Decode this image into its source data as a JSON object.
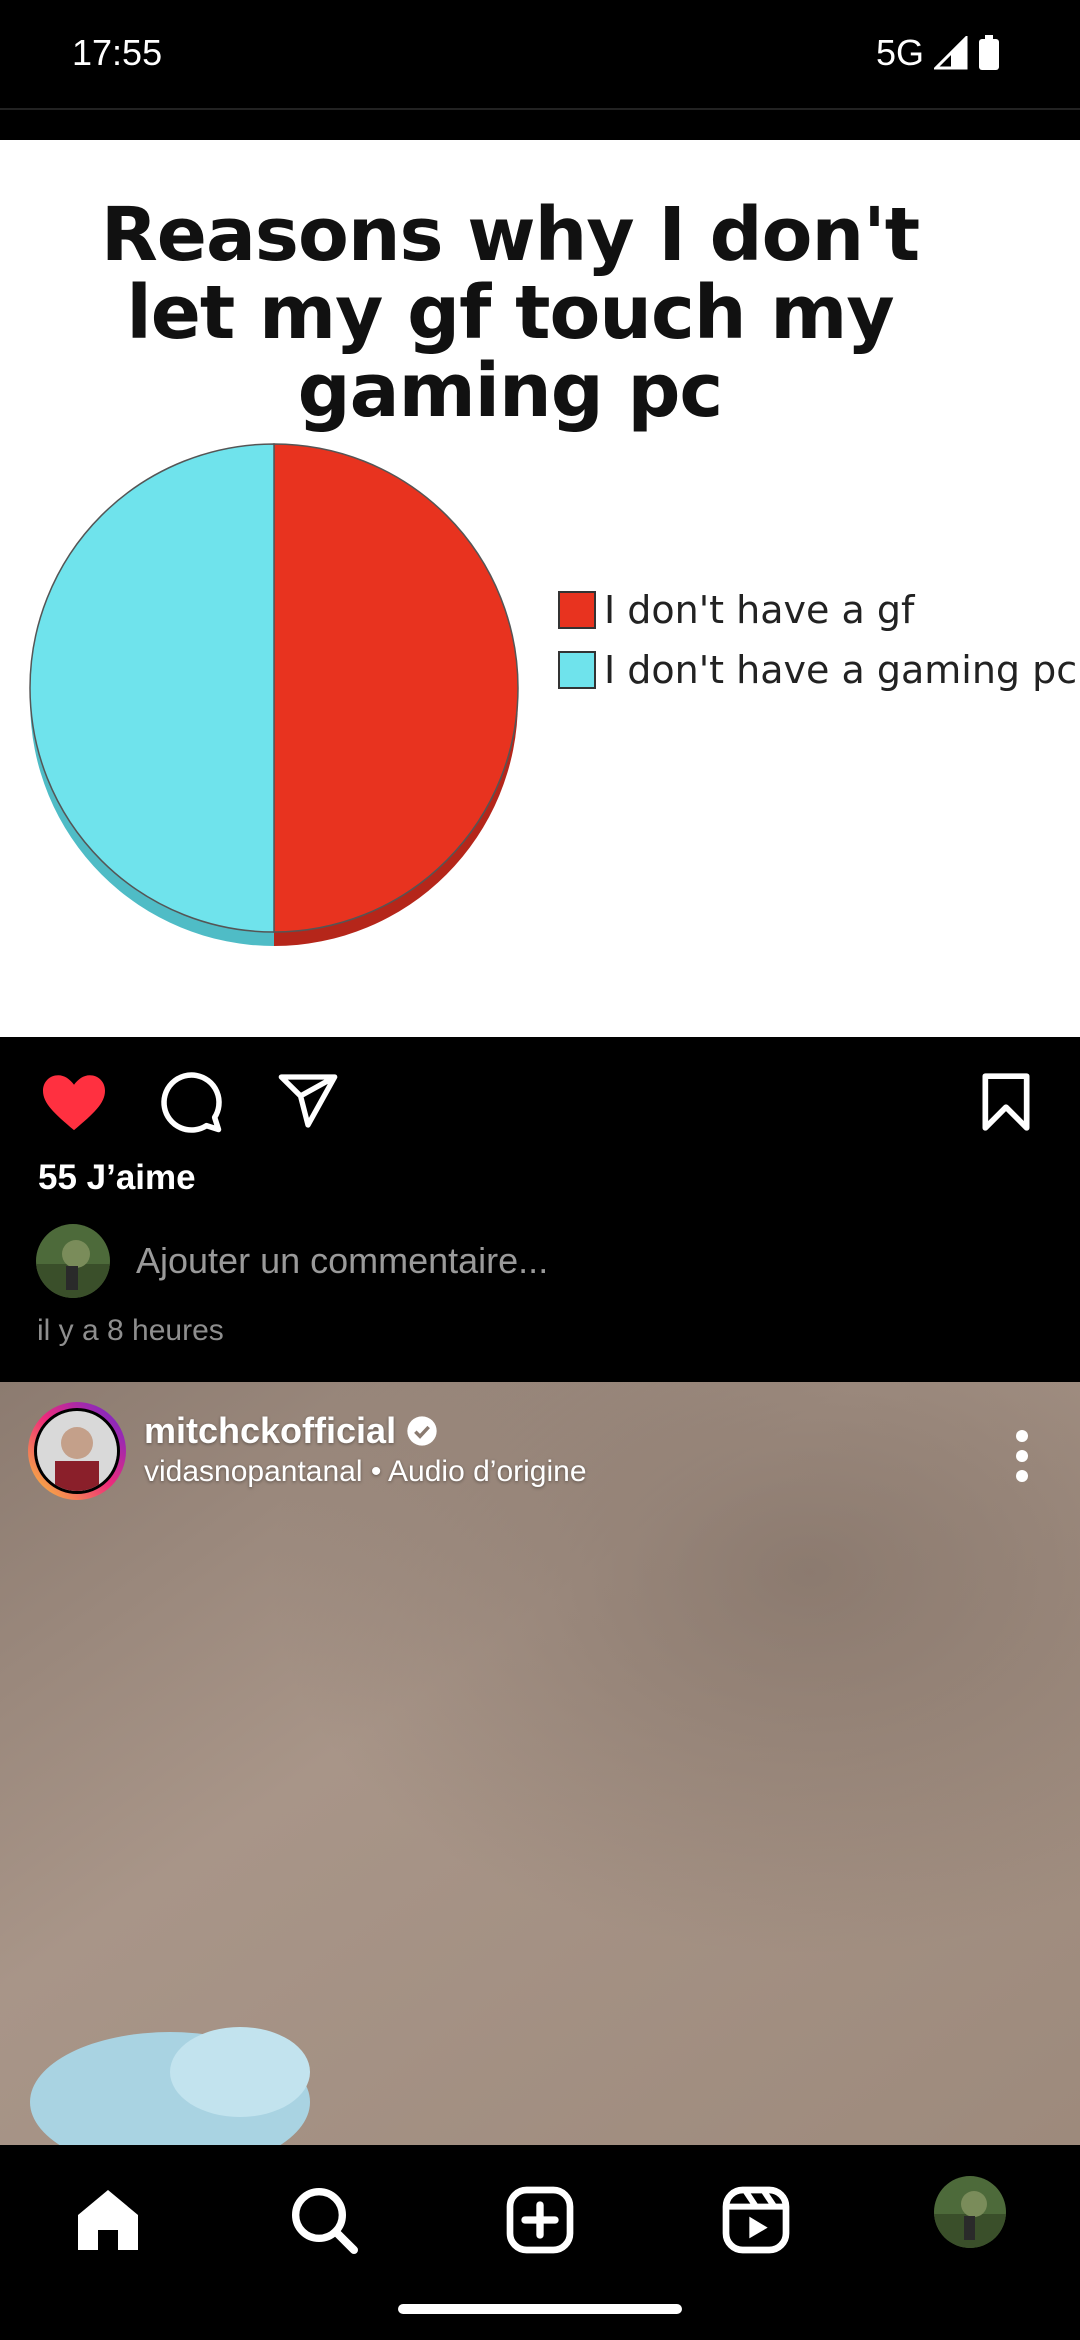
{
  "status_bar": {
    "time": "17:55",
    "network": "5G"
  },
  "post": {
    "meme": {
      "title": "Reasons why I don't let my gf touch my gaming pc",
      "legend": [
        {
          "label": "I don't have a gf",
          "color": "#e8331f"
        },
        {
          "label": "I don't have a gaming pc",
          "color": "#6fe3ec"
        }
      ]
    },
    "liked": true,
    "likes_label": "55 J’aime",
    "comment_placeholder": "Ajouter un commentaire...",
    "time_ago": "il y a 8 heures"
  },
  "chart_data": {
    "type": "pie",
    "title": "Reasons why I don't let my gf touch my gaming pc",
    "slices": [
      {
        "label": "I don't have a gf",
        "value": 50,
        "color": "#e8331f"
      },
      {
        "label": "I don't have a gaming pc",
        "value": 50,
        "color": "#6fe3ec"
      }
    ],
    "legend_position": "right"
  },
  "reel": {
    "username": "mitchckofficial",
    "verified": true,
    "subtitle": "vidasnopantanal • Audio d’origine"
  },
  "icons": {
    "like": "heart-icon",
    "comment": "comment-icon",
    "share": "send-icon",
    "save": "bookmark-icon",
    "more": "more-vertical-icon",
    "nav": [
      "home-icon",
      "search-icon",
      "create-icon",
      "reels-icon",
      "profile-avatar"
    ]
  }
}
